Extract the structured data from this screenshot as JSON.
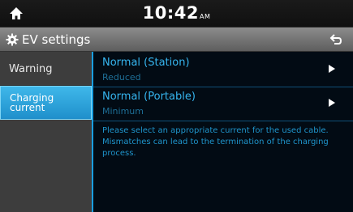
{
  "status_bar": {
    "time": "10:42",
    "ampm": "AM"
  },
  "title_bar": {
    "title": "EV settings"
  },
  "sidebar": {
    "items": [
      {
        "label": "Warning"
      },
      {
        "label_line1": "Charging",
        "label_line2": "current"
      }
    ]
  },
  "main": {
    "items": [
      {
        "title": "Normal (Station)",
        "value": "Reduced"
      },
      {
        "title": "Normal (Portable)",
        "value": "Minimum"
      }
    ],
    "info_line1": "Please select an appropriate current for the used cable.",
    "info_line2": "Mismatches can lead to the termination of the charging process."
  },
  "colors": {
    "accent": "#36b6f0",
    "sidebar_active": "#2aa6de",
    "content_bg": "#020b14"
  },
  "icons": [
    "home-icon",
    "gear-icon",
    "back-arrow-icon",
    "chevron-right-icon"
  ]
}
